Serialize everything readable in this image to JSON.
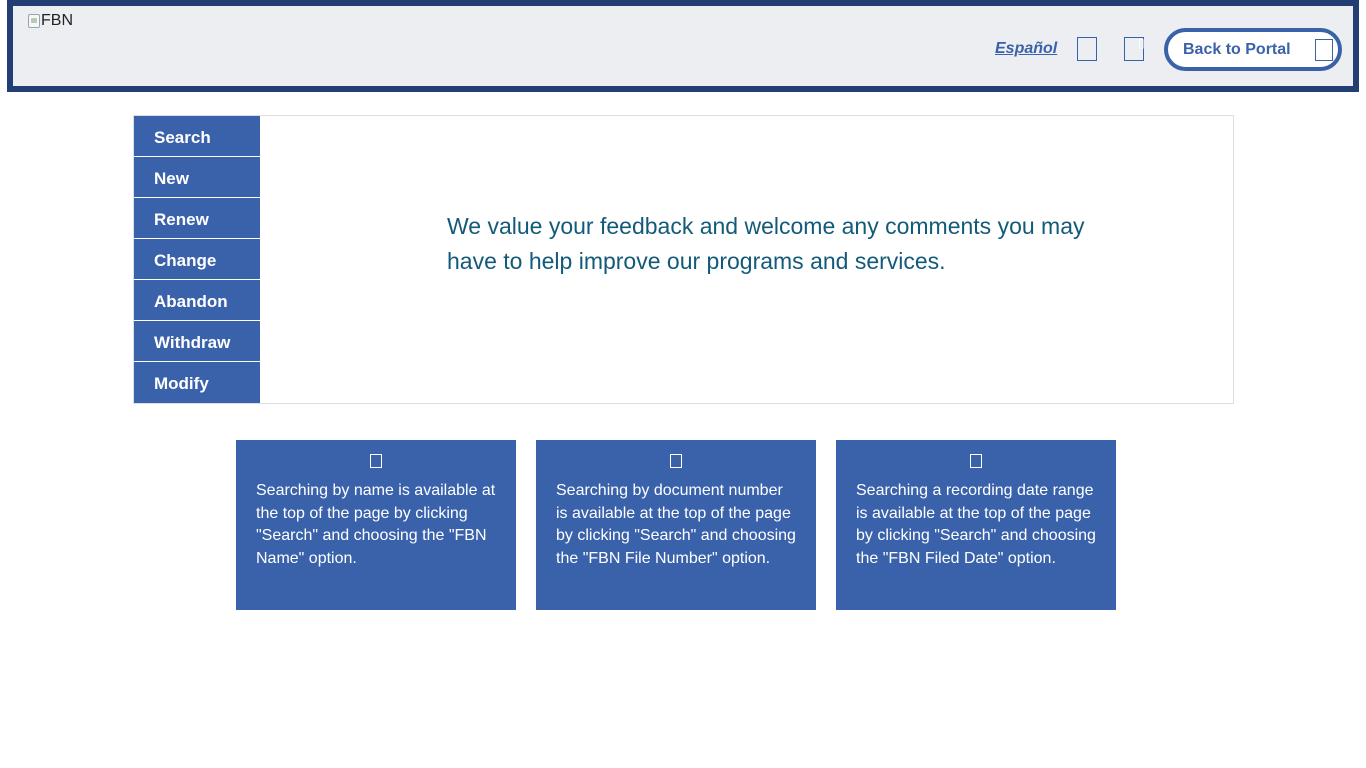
{
  "header": {
    "logo_alt": "FBN",
    "language_link": "Español",
    "portal_button": "Back to Portal",
    "icons": [
      "box-icon",
      "box-icon",
      "box-icon"
    ]
  },
  "sidebar": {
    "items": [
      {
        "label": "Search"
      },
      {
        "label": "New"
      },
      {
        "label": "Renew"
      },
      {
        "label": "Change"
      },
      {
        "label": "Abandon"
      },
      {
        "label": "Withdraw"
      },
      {
        "label": "Modify"
      }
    ]
  },
  "main": {
    "feedback_text": "We value your feedback and welcome any comments you may have to help improve our programs and services."
  },
  "cards": [
    {
      "icon": "box-icon",
      "text": "Searching by name is available at the top of the page by clicking \"Search\" and choosing the \"FBN Name\" option."
    },
    {
      "icon": "box-icon",
      "text": "Searching by document number is available at the top of the page by clicking \"Search\" and choosing the \"FBN File Number\" option."
    },
    {
      "icon": "box-icon",
      "text": "Searching a recording date range is available at the top of the page by clicking \"Search\" and choosing the \"FBN Filed Date\" option."
    }
  ],
  "colors": {
    "header_border": "#233e72",
    "header_bg": "#eceef1",
    "accent_blue": "#3a62ab",
    "feedback_text": "#135a7a"
  }
}
